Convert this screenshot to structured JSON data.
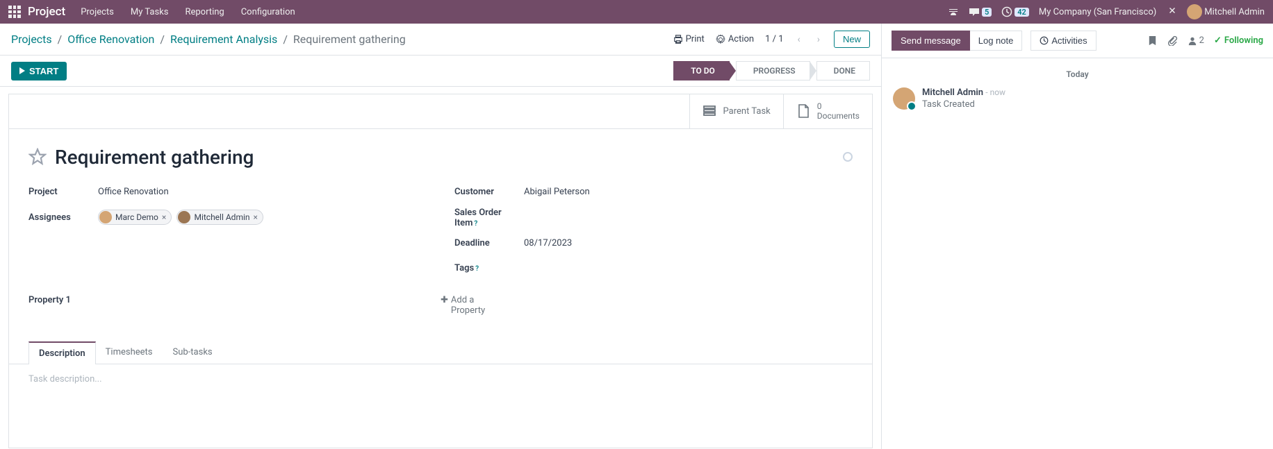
{
  "nav": {
    "brand": "Project",
    "links": [
      "Projects",
      "My Tasks",
      "Reporting",
      "Configuration"
    ],
    "msg_badge": "5",
    "activity_badge": "42",
    "company": "My Company (San Francisco)",
    "user": "Mitchell Admin"
  },
  "breadcrumb": {
    "items": [
      "Projects",
      "Office Renovation",
      "Requirement Analysis"
    ],
    "active": "Requirement gathering",
    "print": "Print",
    "action": "Action",
    "pager": "1 / 1",
    "new_btn": "New"
  },
  "statusbar": {
    "start": "START",
    "stages": [
      "TO DO",
      "PROGRESS",
      "DONE"
    ]
  },
  "sheet": {
    "stat_parent": "Parent Task",
    "stat_docs_num": "0",
    "stat_docs_label": "Documents",
    "title": "Requirement gathering",
    "fields": {
      "project_label": "Project",
      "project_value": "Office Renovation",
      "customer_label": "Customer",
      "customer_value": "Abigail Peterson",
      "assignees_label": "Assignees",
      "assignees": [
        "Marc Demo",
        "Mitchell Admin"
      ],
      "salesorder_label": "Sales Order Item",
      "deadline_label": "Deadline",
      "deadline_value": "08/17/2023",
      "tags_label": "Tags"
    },
    "property1_label": "Property 1",
    "add_property": "Add a Property",
    "tabs": [
      "Description",
      "Timesheets",
      "Sub-tasks"
    ],
    "desc_placeholder": "Task description..."
  },
  "chatter": {
    "send_msg": "Send message",
    "log_note": "Log note",
    "activities": "Activities",
    "followers": "2",
    "following": "Following",
    "date_label": "Today",
    "msg_author": "Mitchell Admin",
    "msg_time": "- now",
    "msg_text": "Task Created"
  }
}
